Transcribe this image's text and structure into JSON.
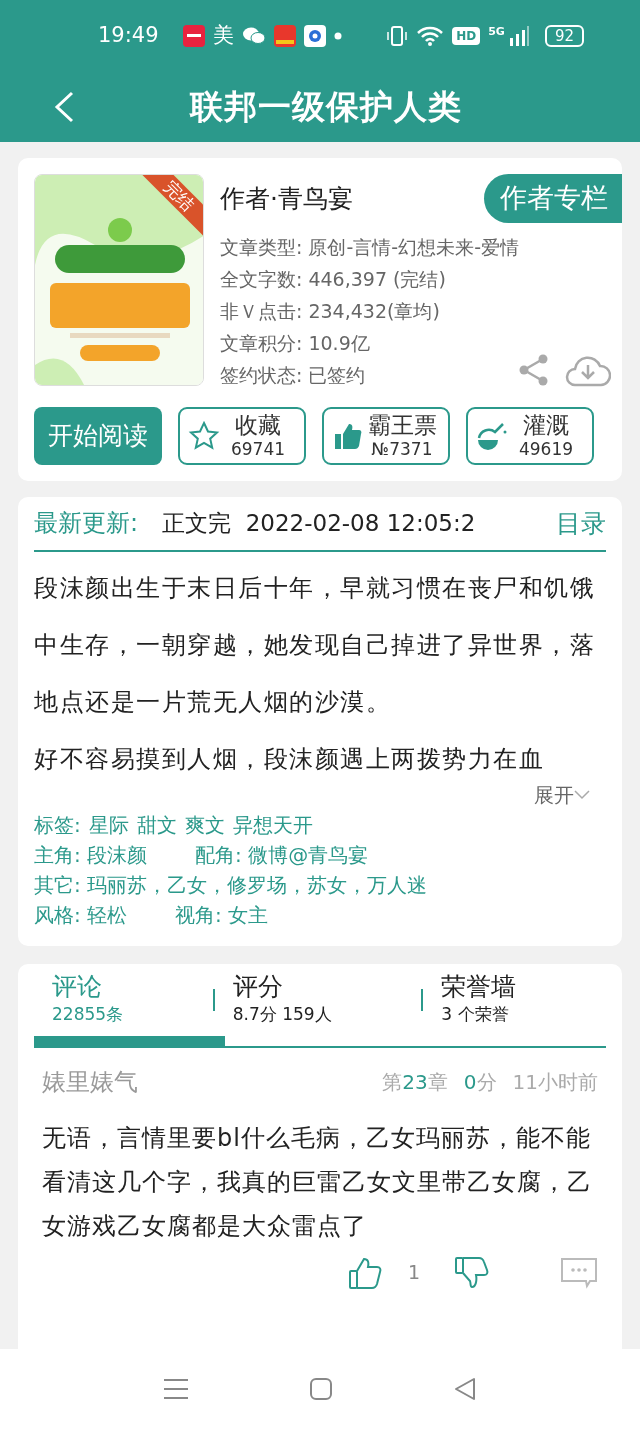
{
  "status_bar": {
    "time": "19:49",
    "notification_text": "美",
    "battery": "92",
    "network": "5G",
    "hd": "HD"
  },
  "header": {
    "title": "联邦一级保护人类"
  },
  "book": {
    "cover": {
      "kind": "picture",
      "ribbon": "完结"
    },
    "author": "作者·青鸟宴",
    "author_button": "作者专栏",
    "info": [
      {
        "label": "文章类型:",
        "value": "原创-言情-幻想未来-爱情"
      },
      {
        "label": "全文字数:",
        "value": "446,397 (完结)"
      },
      {
        "label": "非Ｖ点击:",
        "value": "234,432(章均)"
      },
      {
        "label": "文章积分:",
        "value": "10.9亿"
      },
      {
        "label": "签约状态:",
        "value": " 已签约"
      }
    ],
    "read_button": "开始阅读",
    "actions": [
      {
        "kind": "star",
        "label": "收藏",
        "count": "69741"
      },
      {
        "kind": "thumb",
        "label": "霸王票",
        "count": "№7371"
      },
      {
        "kind": "water",
        "label": "灌溉",
        "count": "49619"
      }
    ]
  },
  "update": {
    "label": "最新更新:",
    "value": "正文完  2022-02-08 12:05:2",
    "catalog": "目录"
  },
  "synopsis": [
    "段沫颜出生于末日后十年，早就习惯在丧尸和饥饿中生存，一朝穿越，她发现自己掉进了异世界，落地点还是一片荒无人烟的沙漠。",
    "好不容易摸到人烟，段沫颜遇上两拨势力在血"
  ],
  "expand": "展开",
  "tags": {
    "label": "标签:",
    "items": [
      "星际",
      "甜文",
      "爽文",
      "异想天开"
    ]
  },
  "details": [
    [
      {
        "label": "主角:",
        "value": "段沫颜"
      },
      {
        "label": "配角:",
        "value": "微博@青鸟宴"
      }
    ],
    [
      {
        "label": "其它:",
        "value": "玛丽苏，乙女，修罗场，苏女，万人迷"
      }
    ],
    [
      {
        "label": "风格:",
        "value": "轻松"
      },
      {
        "label": "视角:",
        "value": "女主"
      }
    ]
  ],
  "tabs": [
    {
      "label": "评论",
      "sub": "22855条",
      "selected": true
    },
    {
      "label": "评分",
      "sub": "8.7分 159人",
      "selected": false
    },
    {
      "label": "荣誉墙",
      "sub": "3 个荣誉",
      "selected": false
    }
  ],
  "comment": {
    "user": "婊里婊气",
    "chapter_prefix": "第",
    "chapter": "23",
    "chapter_suffix": "章",
    "score": "0",
    "score_unit": "分",
    "time": "11小时前",
    "text": "无语，言情里要bl什么毛病，乙女玛丽苏，能不能看清这几个字，我真的巨雷乙女文里带乙女腐，乙女游戏乙女腐都是大众雷点了",
    "likes": "1"
  }
}
